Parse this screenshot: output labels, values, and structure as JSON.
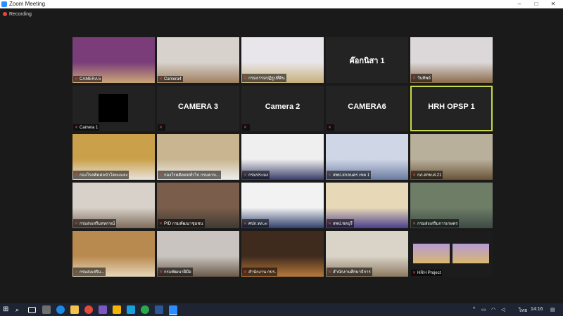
{
  "window": {
    "title": "Zoom Meeting",
    "minimize": "–",
    "maximize": "□",
    "close": "✕"
  },
  "recording": {
    "label": "Recording",
    "color": "#e8453c"
  },
  "participants": [
    {
      "name": "CAMERA 5"
    },
    {
      "name": "Camera4"
    },
    {
      "name": "กรมธรรมปฏิรูปที่ดิน"
    },
    {
      "name": "ค๊อกนิสา 1",
      "centered": true
    },
    {
      "name": "วันทิพย์"
    },
    {
      "name": "Camera 1"
    },
    {
      "name": "CAMERA 3",
      "centered": true
    },
    {
      "name": "Camera 2",
      "centered": true
    },
    {
      "name": "CAMERA6",
      "centered": true
    },
    {
      "name": "HRH OPSP 1",
      "centered": true,
      "active": true
    },
    {
      "name": "กองโรคติดต่อนำโดยแมลง"
    },
    {
      "name": "กองโรคติดต่อทั่วไป กรมควบ..."
    },
    {
      "name": "กรมประมง"
    },
    {
      "name": "สพป.สกลนคร เขต 1"
    },
    {
      "name": "กภ.สกท.ศ.21"
    },
    {
      "name": "กรมส่งเสริมสหกรณ์"
    },
    {
      "name": "PID กรมพัฒนาชุมชน"
    },
    {
      "name": "ศปก.ทภ.๓"
    },
    {
      "name": "สพป.ชลบุรี"
    },
    {
      "name": "กรมส่งเสริมการเกษตร"
    },
    {
      "name": "กรมส่งเสริม..."
    },
    {
      "name": "กรมพัฒนาฝีมือ"
    },
    {
      "name": "สำนักงาน กปร."
    },
    {
      "name": "สำนักงานศึกษาธิการ"
    },
    {
      "name": "HRH Project"
    }
  ],
  "taskbar": {
    "time": "14:16",
    "lang": "ไทย"
  },
  "colors": {
    "accent": "#2d8cff",
    "active_border": "#c8d84b",
    "mute": "#e8453c"
  }
}
